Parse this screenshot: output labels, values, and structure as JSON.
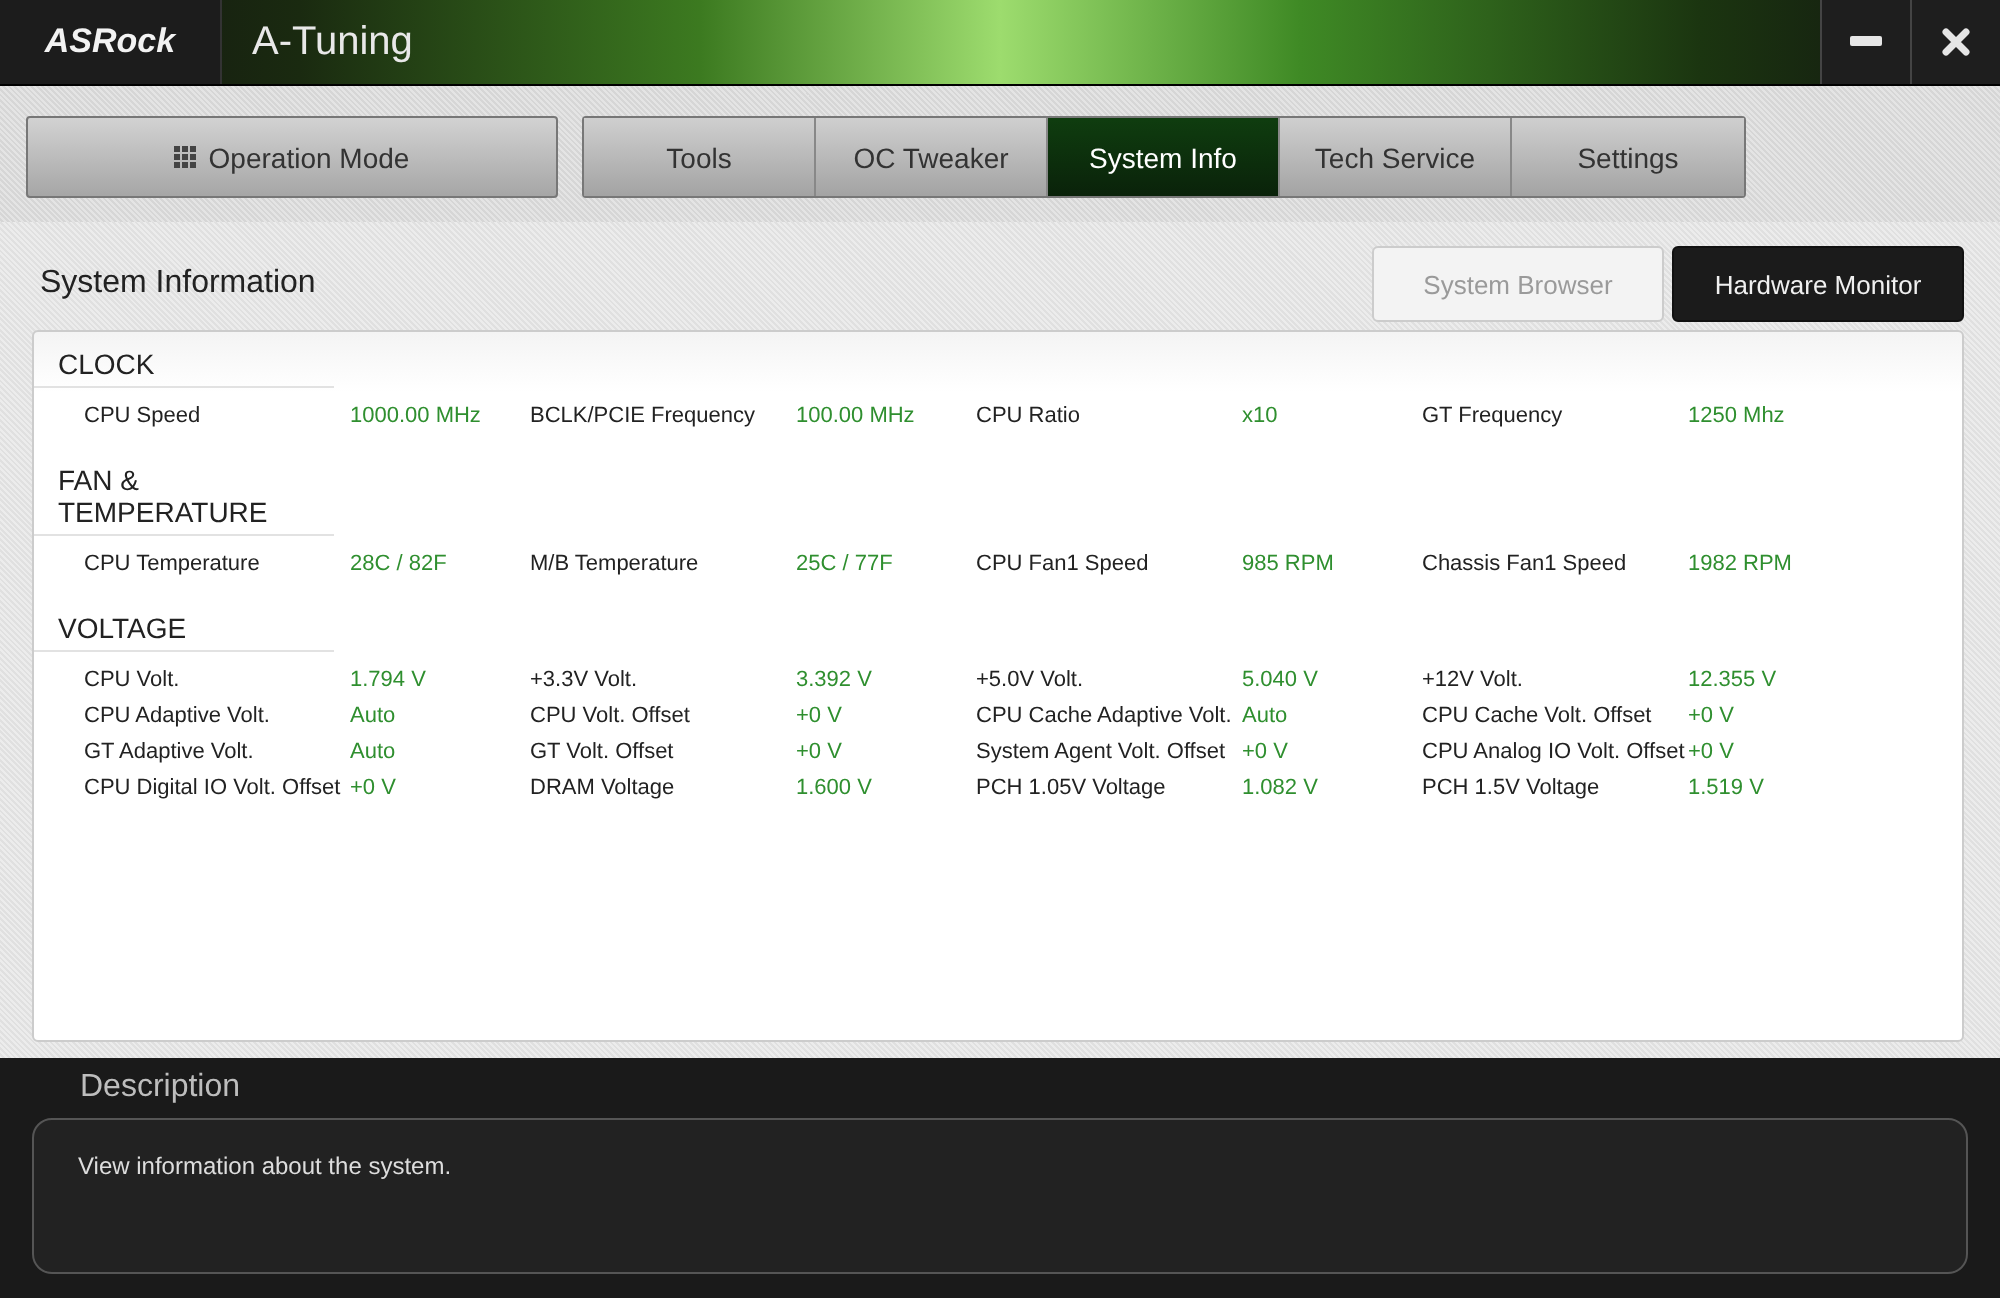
{
  "window": {
    "logo": "ASRock",
    "title": "A-Tuning"
  },
  "operation_mode": {
    "label": "Operation Mode"
  },
  "tabs": [
    {
      "label": "Tools",
      "selected": false
    },
    {
      "label": "OC Tweaker",
      "selected": false
    },
    {
      "label": "System Info",
      "selected": true
    },
    {
      "label": "Tech Service",
      "selected": false
    },
    {
      "label": "Settings",
      "selected": false
    }
  ],
  "page_title": "System Information",
  "view_buttons": [
    {
      "label": "System Browser",
      "disabled": true
    },
    {
      "label": "Hardware Monitor",
      "disabled": false
    }
  ],
  "sections": [
    {
      "title": "CLOCK",
      "rows": [
        [
          {
            "label": "CPU Speed",
            "value": "1000.00 MHz"
          },
          {
            "label": "BCLK/PCIE Frequency",
            "value": "100.00 MHz"
          },
          {
            "label": "CPU Ratio",
            "value": "x10"
          },
          {
            "label": "GT Frequency",
            "value": "1250 Mhz"
          }
        ]
      ]
    },
    {
      "title": "FAN & TEMPERATURE",
      "rows": [
        [
          {
            "label": "CPU Temperature",
            "value": "28C / 82F"
          },
          {
            "label": "M/B Temperature",
            "value": "25C / 77F"
          },
          {
            "label": "CPU Fan1 Speed",
            "value": "985 RPM"
          },
          {
            "label": "Chassis Fan1 Speed",
            "value": "1982 RPM"
          }
        ]
      ]
    },
    {
      "title": "VOLTAGE",
      "rows": [
        [
          {
            "label": "CPU Volt.",
            "value": "1.794 V"
          },
          {
            "label": "+3.3V Volt.",
            "value": "3.392 V"
          },
          {
            "label": "+5.0V Volt.",
            "value": "5.040 V"
          },
          {
            "label": "+12V Volt.",
            "value": "12.355 V"
          }
        ],
        [
          {
            "label": "CPU Adaptive Volt.",
            "value": "Auto"
          },
          {
            "label": "CPU Volt. Offset",
            "value": "+0 V"
          },
          {
            "label": "CPU Cache Adaptive Volt.",
            "value": "Auto"
          },
          {
            "label": "CPU Cache Volt. Offset",
            "value": "+0 V"
          }
        ],
        [
          {
            "label": "GT Adaptive Volt.",
            "value": "Auto"
          },
          {
            "label": "GT Volt. Offset",
            "value": "+0 V"
          },
          {
            "label": "System Agent Volt. Offset",
            "value": "+0 V"
          },
          {
            "label": "CPU Analog IO Volt. Offset",
            "value": "+0 V"
          }
        ],
        [
          {
            "label": "CPU Digital IO Volt. Offset",
            "value": "+0 V"
          },
          {
            "label": "DRAM Voltage",
            "value": "1.600 V"
          },
          {
            "label": "PCH 1.05V Voltage",
            "value": "1.082 V"
          },
          {
            "label": "PCH 1.5V Voltage",
            "value": "1.519 V"
          }
        ]
      ]
    }
  ],
  "description": {
    "title": "Description",
    "text": "View information about the system."
  }
}
